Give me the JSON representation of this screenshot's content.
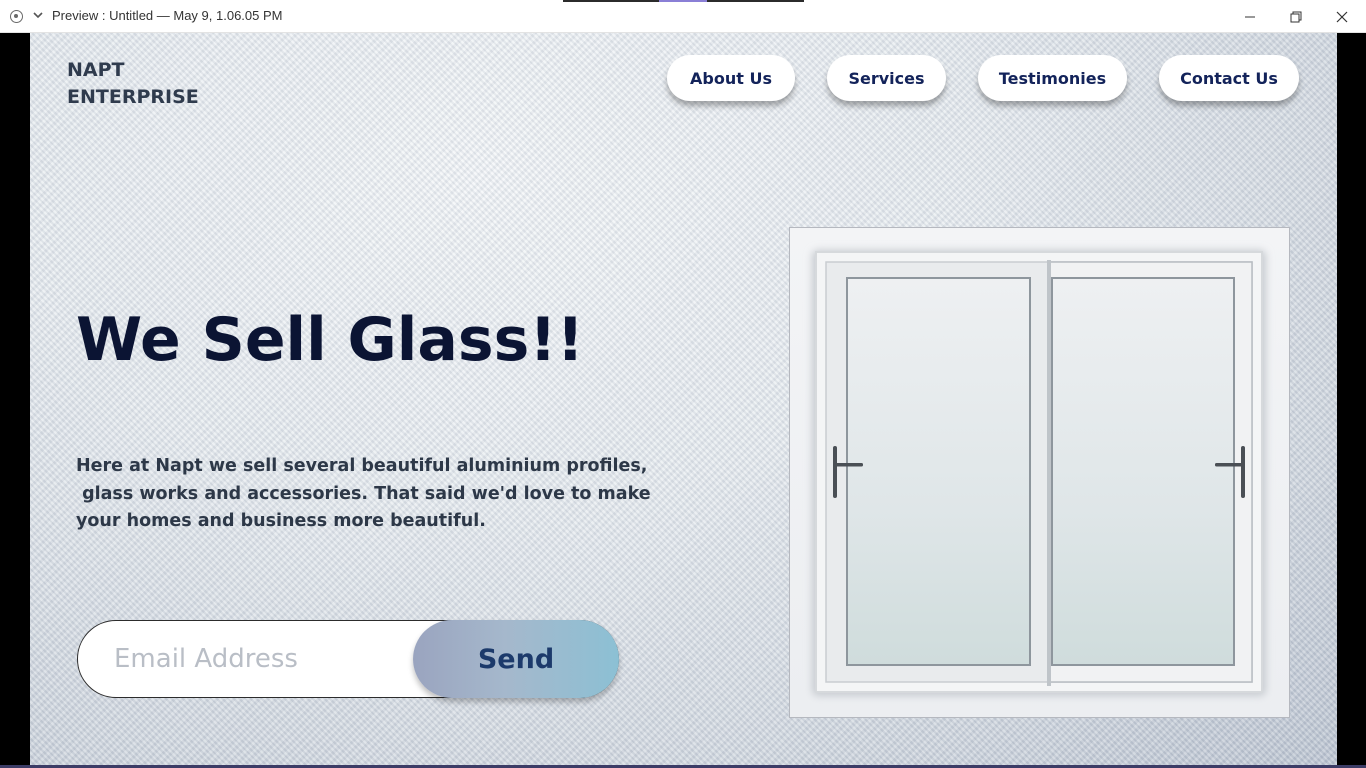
{
  "window": {
    "title": "Preview : Untitled — May 9, 1.06.05 PM"
  },
  "site": {
    "logo_line1": "NAPT",
    "logo_line2": "ENTERPRISE"
  },
  "nav": {
    "items": [
      {
        "label": "About Us"
      },
      {
        "label": "Services"
      },
      {
        "label": "Testimonies"
      },
      {
        "label": "Contact Us"
      }
    ]
  },
  "hero": {
    "title": "We Sell Glass!!",
    "text_lines": [
      "Here at Napt we sell several beautiful aluminium profiles,",
      " glass works and accessories. That said we'd love to make",
      "your homes and business more beautiful."
    ]
  },
  "signup": {
    "email_placeholder": "Email Address",
    "send_label": "Send"
  },
  "colors": {
    "nav_text": "#13235a",
    "title_text": "#0b1433",
    "body_text": "#2d3848",
    "send_text": "#1c3a6b"
  },
  "icons": {
    "window_controls": [
      "minimize-icon",
      "restore-icon",
      "close-icon"
    ],
    "titlebar_left": [
      "record-icon",
      "chevron-down-icon"
    ]
  }
}
